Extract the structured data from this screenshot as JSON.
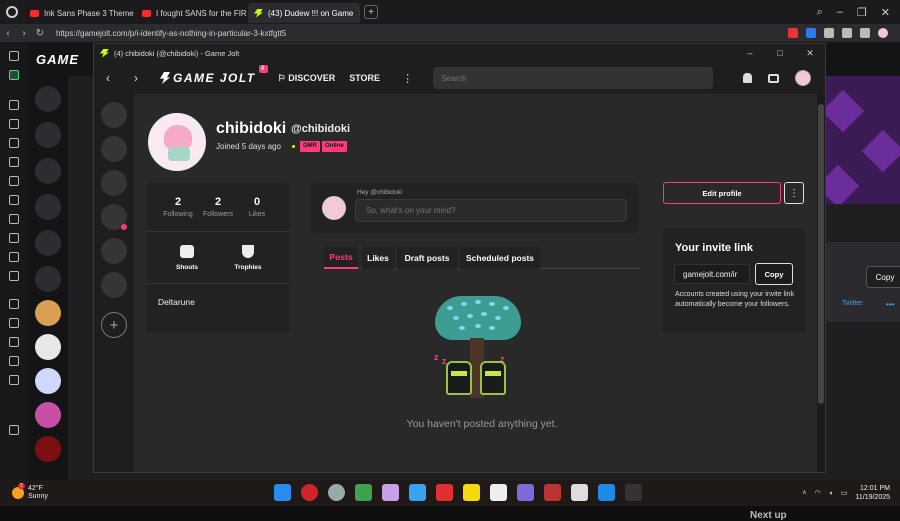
{
  "browser": {
    "tabs": [
      {
        "label": "Ink Sans Phase 3 Theme",
        "icon": "youtube-icon"
      },
      {
        "label": "I fought SANS for the FIR",
        "icon": "youtube-icon"
      },
      {
        "label": "(43) Dudew !!! on Game",
        "icon": "gamejolt-icon"
      }
    ],
    "url": "https://gamejolt.com/p/i-identify-as-nothing-in-particular-3-kxtfgtt5"
  },
  "background_page": {
    "logo": "GAME",
    "copy_label": "Copy",
    "twitter_label": "Twitter",
    "more_label": "•••",
    "next_up": "Next up"
  },
  "window": {
    "title": "(4) chibidoki (@chibidoki) - Game Jolt"
  },
  "topbar": {
    "logo": "GAME JOLT",
    "notif_count": "4",
    "discover": "DISCOVER",
    "store": "STORE",
    "search_placeholder": "Search"
  },
  "profile": {
    "name": "chibidoki",
    "handle": "@chibidoki",
    "joined": "Joined 5 days ago",
    "tags": [
      "GMR",
      "Online"
    ],
    "stats": [
      {
        "n": "2",
        "label": "Following"
      },
      {
        "n": "2",
        "label": "Followers"
      },
      {
        "n": "0",
        "label": "Likes"
      }
    ],
    "shouts": "Shouts",
    "trophies": "Trophies",
    "game": "Deltarune"
  },
  "composer": {
    "hey": "Hey @chibidoki",
    "placeholder": "So, what's on your mind?"
  },
  "tabs": [
    "Posts",
    "Likes",
    "Draft posts",
    "Scheduled posts"
  ],
  "empty_text": "You haven't posted anything yet.",
  "actions": {
    "edit_profile": "Edit profile",
    "more": "⋮"
  },
  "invite": {
    "title": "Your invite link",
    "link": "gamejolt.com/ir",
    "copy": "Copy",
    "desc": "Accounts created using your invite link automatically become your followers."
  },
  "taskbar": {
    "temp": "42°F",
    "condition": "Sunny",
    "weather_badge": "2",
    "time": "12:01 PM",
    "date": "11/19/2025"
  },
  "colors": {
    "accent": "#ff3b7a",
    "brand_green": "#ccff00",
    "panel": "#222222"
  }
}
